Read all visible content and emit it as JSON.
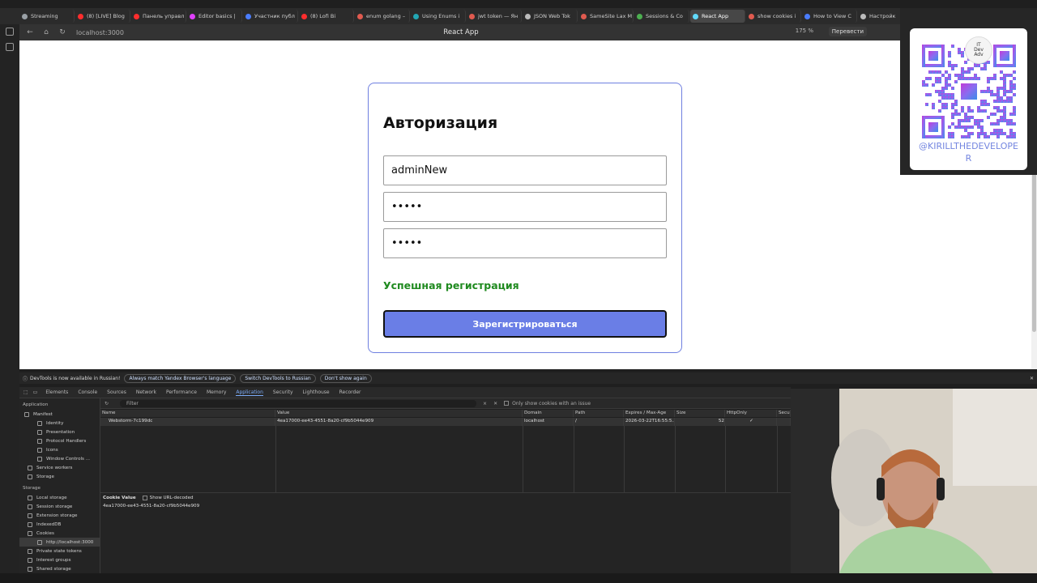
{
  "browser": {
    "tabs": [
      {
        "label": "Streaming",
        "color": "#9aa0a6"
      },
      {
        "label": "(8) [LIVE] Blog",
        "color": "#ff2d2d"
      },
      {
        "label": "Панель управл",
        "color": "#ff2d2d"
      },
      {
        "label": "Editor basics |",
        "color": "#e040fb"
      },
      {
        "label": "Участник публ",
        "color": "#4a7dff"
      },
      {
        "label": "(8) Lofi Bi",
        "color": "#ff2d2d"
      },
      {
        "label": "enum golang –",
        "color": "#e05a4f"
      },
      {
        "label": "Using Enums i",
        "color": "#22a6b3"
      },
      {
        "label": "jwt token — Ян",
        "color": "#e05a4f"
      },
      {
        "label": "JSON Web Tok",
        "color": "#bbbbbb"
      },
      {
        "label": "SameSite Lax M",
        "color": "#e05a4f"
      },
      {
        "label": "Sessions & Co",
        "color": "#4caf50"
      },
      {
        "label": "React App",
        "color": "#61dafb"
      },
      {
        "label": "show cookies i",
        "color": "#e05a4f"
      },
      {
        "label": "How to View C",
        "color": "#4a7dff"
      },
      {
        "label": "Настройк",
        "color": "#bbbbbb"
      }
    ],
    "active_tab_index": 12,
    "url": "localhost:3000",
    "page_title": "React App",
    "zoom": "175 %",
    "translate_label": "Перевести"
  },
  "form": {
    "title": "Авторизация",
    "username_value": "adminNew",
    "password_value": "•••••",
    "password_confirm_value": "•••••",
    "success_message": "Успешная регистрация",
    "submit_label": "Зарегистрироваться"
  },
  "overlay": {
    "qr_handle": "@KIRILLTHEDEVELOPER",
    "logo_text": "IT Dev Adventure"
  },
  "devtools": {
    "infobar": {
      "message": "DevTools is now available in Russian!",
      "buttons": [
        "Always match Yandex Browser's language",
        "Switch DevTools to Russian",
        "Don't show again"
      ]
    },
    "tabs": [
      "Elements",
      "Console",
      "Sources",
      "Network",
      "Performance",
      "Memory",
      "Application",
      "Security",
      "Lighthouse",
      "Recorder"
    ],
    "active_tab": "Application",
    "sidebar": {
      "application_heading": "Application",
      "application_items": [
        "Manifest",
        "Identity",
        "Presentation",
        "Protocol Handlers",
        "Icons",
        "Window Controls ...",
        "Service workers",
        "Storage"
      ],
      "storage_heading": "Storage",
      "storage_items": [
        "Local storage",
        "Session storage",
        "Extension storage",
        "IndexedDB",
        "Cookies",
        "http://localhost:3000",
        "Private state tokens",
        "Interest groups",
        "Shared storage"
      ]
    },
    "filter_placeholder": "Filter",
    "only_issue_label": "Only show cookies with an issue",
    "columns": [
      "Name",
      "Value",
      "Domain",
      "Path",
      "Expires / Max-Age",
      "Size",
      "HttpOnly",
      "Secur"
    ],
    "rows": [
      [
        "Webstorm-7c199dc",
        "4ea17000-ee43-4551-8a20-cf9b5044e909",
        "localhost",
        "/",
        "2026-03-22T16:55:5...",
        "52",
        "✓",
        ""
      ]
    ],
    "cookie_value_label": "Cookie Value",
    "show_url_decoded_label": "Show URL-decoded",
    "cookie_value": "4ea17000-ee43-4551-8a20-cf9b5044e909"
  }
}
